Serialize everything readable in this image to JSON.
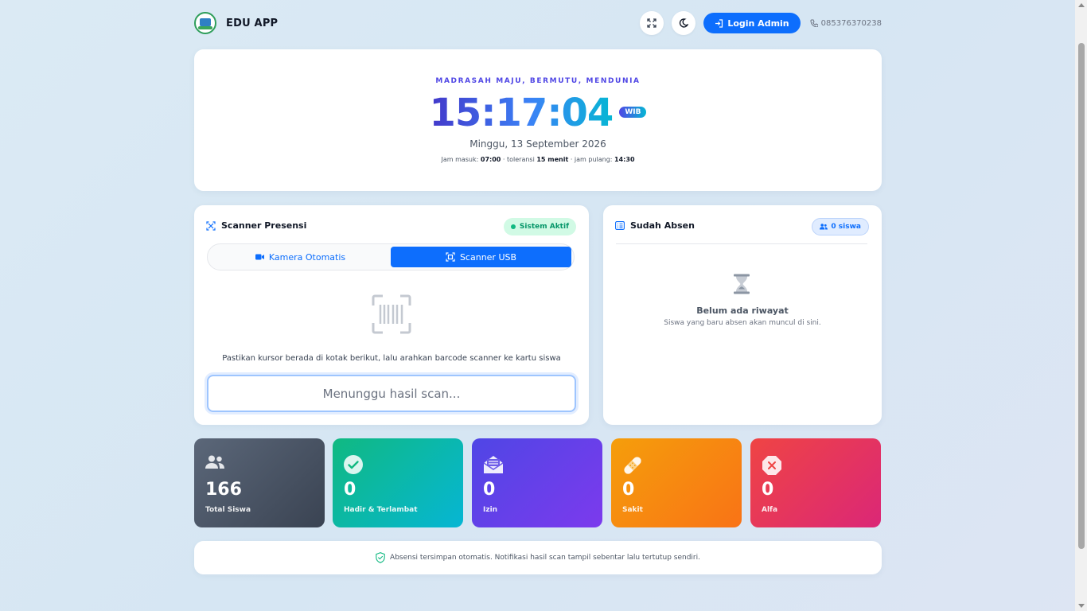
{
  "header": {
    "brand_name": "EDU APP",
    "login_label": "Login Admin",
    "phone": "085376370238"
  },
  "clock": {
    "motto": "MADRASAH MAJU, BERMUTU, MENDUNIA",
    "time": "15:17:04",
    "timezone": "WIB",
    "date": "Minggu, 13 September 2026",
    "hours": {
      "in_label": "Jam masuk:",
      "in_value": "07:00",
      "tol_label": " · toleransi ",
      "tol_value": "15 menit",
      "out_label": " · jam pulang: ",
      "out_value": "14:30"
    }
  },
  "scanner": {
    "title": "Scanner Presensi",
    "status": "Sistem Aktif",
    "tabs": [
      {
        "label": "Kamera Otomatis",
        "active": false
      },
      {
        "label": "Scanner USB",
        "active": true
      }
    ],
    "instruction": "Pastikan kursor berada di kotak berikut, lalu arahkan barcode scanner ke kartu siswa",
    "input_placeholder": "Menunggu hasil scan..."
  },
  "history": {
    "title": "Sudah Absen",
    "count_badge": "0 siswa",
    "empty_title": "Belum ada riwayat",
    "empty_subtitle": "Siswa yang baru absen akan muncul di sini."
  },
  "stats": [
    {
      "value": "166",
      "label": "Total Siswa",
      "icon": "users-icon"
    },
    {
      "value": "0",
      "label": "Hadir & Terlambat",
      "icon": "check-circle-icon"
    },
    {
      "value": "0",
      "label": "Izin",
      "icon": "envelope-open-icon"
    },
    {
      "value": "0",
      "label": "Sakit",
      "icon": "bandage-icon"
    },
    {
      "value": "0",
      "label": "Alfa",
      "icon": "x-octagon-icon"
    }
  ],
  "footer": {
    "text": "Absensi tersimpan otomatis. Notifikasi hasil scan tampil sebentar lalu tertutup sendiri."
  },
  "colors": {
    "primary": "#0d6efd",
    "success": "#10b981",
    "accent": "#4f46e5"
  }
}
